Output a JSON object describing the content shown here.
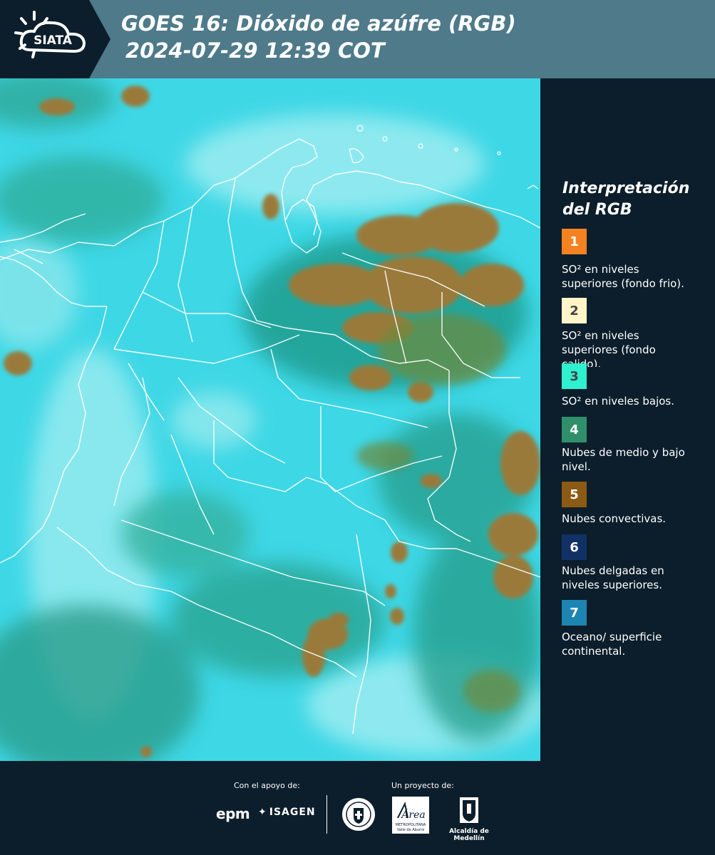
{
  "header": {
    "brand": "SIATA",
    "title_line1": "GOES 16: Dióxido de azúfre (RGB)",
    "title_line2": "2024-07-29 12:39 COT",
    "background_color": "#4e7a8a"
  },
  "legend": {
    "title_line1": "Interpretación",
    "title_line2": "del RGB",
    "items": [
      {
        "number": "1",
        "color": "#f58220",
        "label": "SO² en niveles superiores (fondo frio)."
      },
      {
        "number": "2",
        "color": "#fff5c8",
        "label": "SO² en niveles superiores (fondo calido)."
      },
      {
        "number": "3",
        "color": "#2ff0d0",
        "label": "SO² en niveles bajos."
      },
      {
        "number": "4",
        "color": "#2f8f6a",
        "label": "Nubes de medio y bajo nivel."
      },
      {
        "number": "5",
        "color": "#8b5a14",
        "label": "Nubes convectivas."
      },
      {
        "number": "6",
        "color": "#113166",
        "label": "Nubes delgadas en niveles superiores."
      },
      {
        "number": "7",
        "color": "#1d85b2",
        "label": "Oceano/ superficie continental."
      }
    ]
  },
  "map": {
    "background_color": "#3ed7e6",
    "icon": "satellite-rgb-map"
  },
  "footer": {
    "support_label": "Con el apoyo de:",
    "project_label": "Un proyecto de:",
    "sponsor1": "epm",
    "sponsor2": "ISAGEN",
    "area_logo_text": "Área",
    "area_sub1": "METROPOLITANA",
    "area_sub2": "Valle de Aburrá",
    "alcaldia": "Alcaldía de Medellín"
  }
}
